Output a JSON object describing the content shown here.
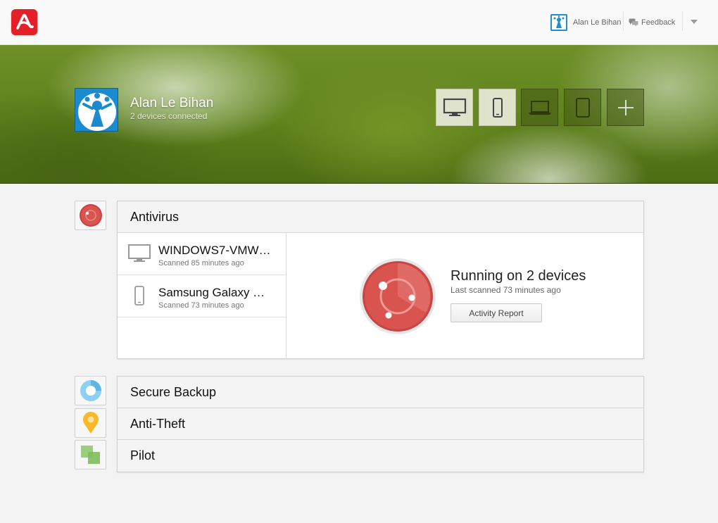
{
  "topbar": {
    "logo_icon": "avira-umbrella-logo-icon",
    "user_name": "Alan Le Bihan",
    "feedback_label": "Feedback",
    "menu_icon": "chevron-down-icon"
  },
  "hero": {
    "user_name": "Alan Le Bihan",
    "subtitle": "2 devices connected",
    "device_buttons": [
      {
        "icon": "desktop-icon",
        "state": "active"
      },
      {
        "icon": "phone-icon",
        "state": "active"
      },
      {
        "icon": "laptop-icon",
        "state": "inactive"
      },
      {
        "icon": "tablet-icon",
        "state": "inactive"
      },
      {
        "icon": "plus-icon",
        "state": "inactive"
      }
    ]
  },
  "antivirus": {
    "title": "Antivirus",
    "devices": [
      {
        "name": "WINDOWS7-VMW…",
        "status": "Scanned 85 minutes ago",
        "icon": "desktop-icon"
      },
      {
        "name": "Samsung Galaxy …",
        "status": "Scanned 73 minutes ago",
        "icon": "phone-icon"
      }
    ],
    "status_title": "Running on 2 devices",
    "status_subtitle": "Last scanned 73 minutes ago",
    "activity_button": "Activity Report"
  },
  "modules": [
    {
      "title": "Secure Backup",
      "icon": "backup-ring-icon"
    },
    {
      "title": "Anti-Theft",
      "icon": "location-pin-icon"
    },
    {
      "title": "Pilot",
      "icon": "pilot-squares-icon"
    }
  ],
  "colors": {
    "brand_red": "#e32028",
    "antivirus_red": "#d9534f",
    "avatar_blue": "#1b8bd0",
    "hero_green": "#5f821c"
  }
}
